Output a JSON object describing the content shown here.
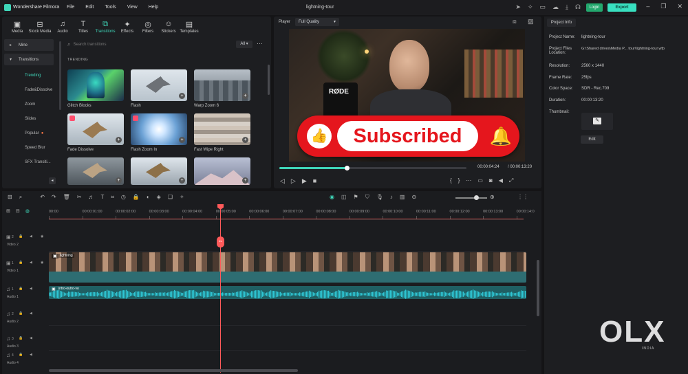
{
  "app": {
    "title": "Wondershare Filmora",
    "document": "lightning-tour"
  },
  "menu": [
    "File",
    "Edit",
    "Tools",
    "View",
    "Help"
  ],
  "header": {
    "login": "Login",
    "export": "Export"
  },
  "tabs": [
    {
      "label": "Media",
      "icon": "media-icon"
    },
    {
      "label": "Stock Media",
      "icon": "stock-media-icon"
    },
    {
      "label": "Audio",
      "icon": "audio-icon"
    },
    {
      "label": "Titles",
      "icon": "titles-icon"
    },
    {
      "label": "Transitions",
      "icon": "transitions-icon",
      "active": true
    },
    {
      "label": "Effects",
      "icon": "effects-icon"
    },
    {
      "label": "Filters",
      "icon": "filters-icon"
    },
    {
      "label": "Stickers",
      "icon": "stickers-icon"
    },
    {
      "label": "Templates",
      "icon": "templates-icon"
    }
  ],
  "sidebar": {
    "sections": [
      {
        "label": "Mine"
      },
      {
        "label": "Transitions"
      }
    ],
    "items": [
      {
        "label": "Trending",
        "active": true
      },
      {
        "label": "Fade&Dissolve"
      },
      {
        "label": "Zoom"
      },
      {
        "label": "Slides"
      },
      {
        "label": "Popular"
      },
      {
        "label": "Speed Blur"
      },
      {
        "label": "SFX Transiti..."
      }
    ]
  },
  "search": {
    "placeholder": "Search transitions",
    "filter": "All"
  },
  "grid": {
    "section_label": "TRENDING",
    "items": [
      {
        "label": "Glitch Blocks"
      },
      {
        "label": "Flash"
      },
      {
        "label": "Warp Zoom 6"
      },
      {
        "label": "Fade Dissolve"
      },
      {
        "label": "Flash Zoom In"
      },
      {
        "label": "Fast Wipe Right"
      },
      {
        "label": ""
      },
      {
        "label": ""
      },
      {
        "label": ""
      }
    ]
  },
  "player": {
    "label": "Player",
    "quality": "Full Quality",
    "overlay_text": "Subscribed",
    "current_time": "00:00:04:24",
    "total_time": "/ 00:00:13:20",
    "progress": 0.36
  },
  "project_info": {
    "tab": "Project Info",
    "rows": [
      {
        "k": "Project Name:",
        "v": "lightning-tour"
      },
      {
        "k": "Project Files Location:",
        "v": "G:\\Shared drives\\Media P... tour\\lightning-tour.wfp"
      },
      {
        "k": "Resolution:",
        "v": "2560 x 1440"
      },
      {
        "k": "Frame Rate:",
        "v": "25fps"
      },
      {
        "k": "Color Space:",
        "v": "SDR - Rec.709"
      },
      {
        "k": "Duration:",
        "v": "00:00:13:20"
      },
      {
        "k": "Thumbnail:",
        "v": ""
      }
    ],
    "edit_button": "Edit"
  },
  "timeline": {
    "ruler": [
      "00:00",
      "00:00:01:00",
      "00:00:02:00",
      "00:00:03:00",
      "00:00:04:00",
      "00:00:05:00",
      "00:00:06:00",
      "00:00:07:00",
      "00:00:08:00",
      "00:00:09:00",
      "00:00:10:00",
      "00:00:11:00",
      "00:00:12:00",
      "00:00:13:00",
      "00:00:14:0"
    ],
    "tracks": [
      {
        "name": "Video 2",
        "num": "2"
      },
      {
        "name": "Video 1",
        "num": "1"
      },
      {
        "name": "Audio 1",
        "num": "1"
      },
      {
        "name": "Audio 2",
        "num": "2"
      },
      {
        "name": "Audio 3",
        "num": "3"
      },
      {
        "name": "Audio 4",
        "num": "4"
      }
    ],
    "video_clip_label": "lightning",
    "audio_clip_label": "intro-outro-vo",
    "playhead_time": "00:00:05:00"
  },
  "watermark": {
    "text": "OLX",
    "sub": "INDIA"
  },
  "colors": {
    "accent": "#3fd6b9",
    "playhead": "#ff5a5a",
    "subscribe_red": "#e5161d",
    "video_clip": "#2e6d72",
    "audio_clip": "#1f5f63",
    "waveform": "#2ec6d4"
  }
}
